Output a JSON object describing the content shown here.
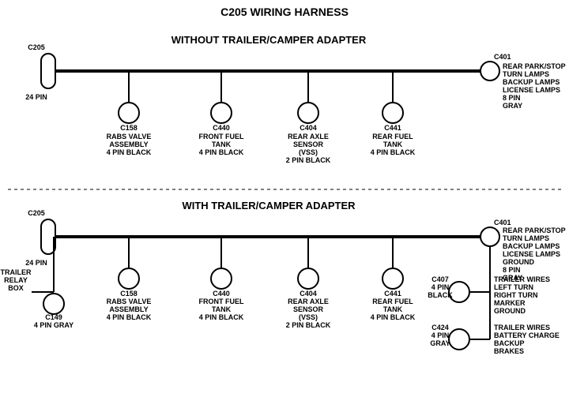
{
  "title": "C205 WIRING HARNESS",
  "section1": {
    "label": "WITHOUT  TRAILER/CAMPER  ADAPTER",
    "left_connector": {
      "id": "C205",
      "pin_label": "24 PIN"
    },
    "right_connector": {
      "id": "C401",
      "pin_label": "8 PIN",
      "color": "GRAY",
      "description": "REAR PARK/STOP\nTURN LAMPS\nBACKUP LAMPS\nLICENSE LAMPS"
    },
    "connectors": [
      {
        "id": "C158",
        "label": "C158\nRABS VALVE\nASSEMBLY\n4 PIN BLACK"
      },
      {
        "id": "C440",
        "label": "C440\nFRONT FUEL\nTANK\n4 PIN BLACK"
      },
      {
        "id": "C404",
        "label": "C404\nREAR AXLE\nSENSOR\n(VSS)\n2 PIN BLACK"
      },
      {
        "id": "C441",
        "label": "C441\nREAR FUEL\nTANK\n4 PIN BLACK"
      }
    ]
  },
  "section2": {
    "label": "WITH  TRAILER/CAMPER  ADAPTER",
    "left_connector": {
      "id": "C205",
      "pin_label": "24 PIN"
    },
    "right_connector": {
      "id": "C401",
      "pin_label": "8 PIN",
      "color": "GRAY",
      "description": "REAR PARK/STOP\nTURN LAMPS\nBACKUP LAMPS\nLICENSE LAMPS\nGROUND"
    },
    "connectors": [
      {
        "id": "C158",
        "label": "C158\nRABS VALVE\nASSEMBLY\n4 PIN BLACK"
      },
      {
        "id": "C440",
        "label": "C440\nFRONT FUEL\nTANK\n4 PIN BLACK"
      },
      {
        "id": "C404",
        "label": "C404\nREAR AXLE\nSENSOR\n(VSS)\n2 PIN BLACK"
      },
      {
        "id": "C441",
        "label": "C441\nREAR FUEL\nTANK\n4 PIN BLACK"
      }
    ],
    "extra_left": {
      "label": "TRAILER\nRELAY\nBOX",
      "connector": {
        "id": "C149",
        "label": "C149\n4 PIN GRAY"
      }
    },
    "extra_right": [
      {
        "id": "C407",
        "pin_label": "4 PIN",
        "color": "BLACK",
        "description": "TRAILER WIRES\nLEFT TURN\nRIGHT TURN\nMARKER\nGROUND"
      },
      {
        "id": "C424",
        "pin_label": "4 PIN",
        "color": "GRAY",
        "description": "TRAILER WIRES\nBATTERY CHARGE\nBACKUP\nBRAKES"
      }
    ]
  }
}
